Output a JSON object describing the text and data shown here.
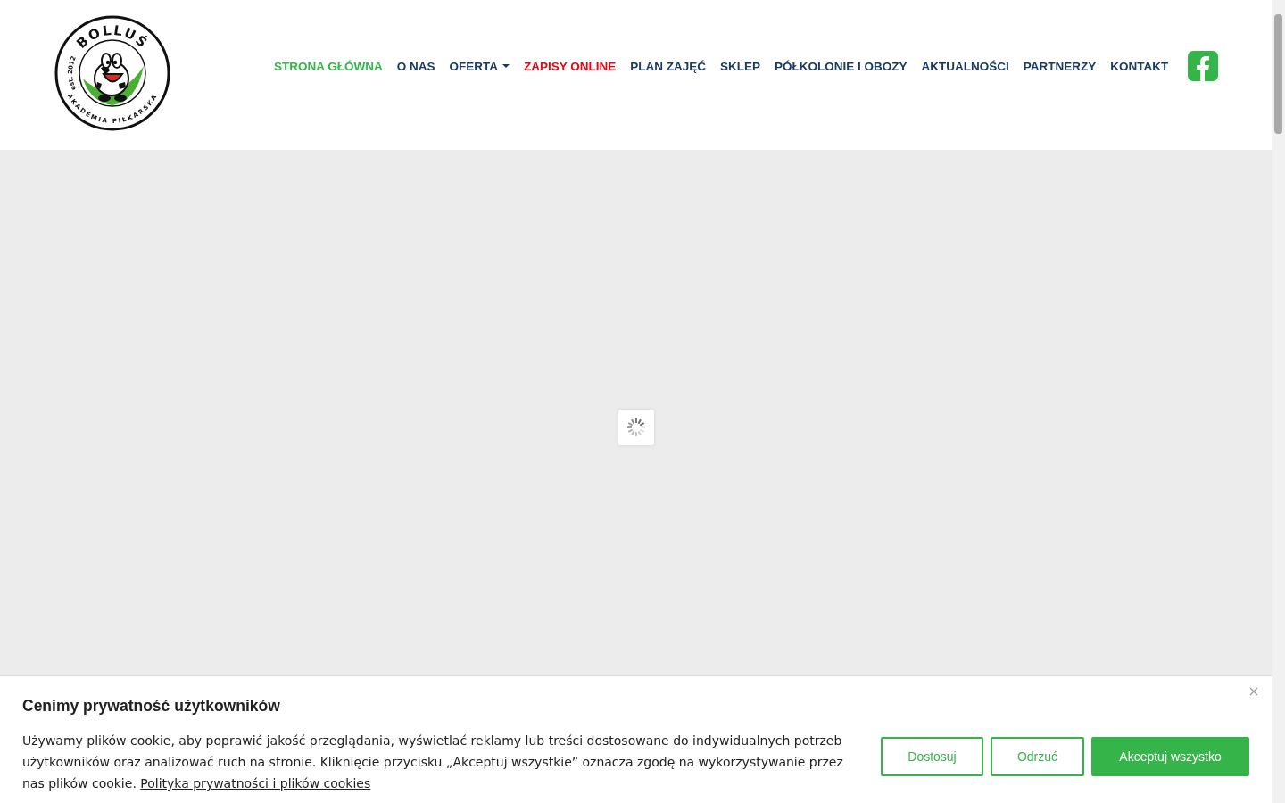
{
  "logo": {
    "name": "BOLLUŚ",
    "established": "est. 2012",
    "tagline": "AKADEMIA PIŁKARSKA"
  },
  "nav": [
    {
      "label": "STRONA GŁÓWNA",
      "kind": "link",
      "selected": true
    },
    {
      "label": "O NAS",
      "kind": "link",
      "selected": false
    },
    {
      "label": "OFERTA",
      "kind": "dropdown",
      "selected": false
    },
    {
      "label": "ZAPISY ONLINE",
      "kind": "highlight",
      "selected": false
    },
    {
      "label": "PLAN ZAJĘĆ",
      "kind": "link",
      "selected": false
    },
    {
      "label": "SKLEP",
      "kind": "link",
      "selected": false
    },
    {
      "label": "PÓŁKOLONIE I OBOZY",
      "kind": "link",
      "selected": false
    },
    {
      "label": "AKTUALNOŚCI",
      "kind": "link",
      "selected": false
    },
    {
      "label": "PARTNERZY",
      "kind": "link",
      "selected": false
    },
    {
      "label": "KONTAKT",
      "kind": "link",
      "selected": false
    }
  ],
  "cookie_banner": {
    "title": "Cenimy prywatność użytkowników",
    "text": "Używamy plików cookie, aby poprawić jakość przeglądania, wyświetlać reklamy lub treści dostosowane do indywidualnych potrzeb użytkowników oraz analizować ruch na stronie. Kliknięcie przycisku „Akceptuj wszystkie” oznacza zgodę na wykorzystywanie przez nas plików cookie.",
    "link": "Polityka prywatności i plików cookies",
    "buttons": [
      {
        "label": "Dostosuj",
        "kind": "outline"
      },
      {
        "label": "Odrzuć",
        "kind": "outline"
      },
      {
        "label": "Akceptuj wszystko",
        "kind": "primary"
      }
    ]
  }
}
